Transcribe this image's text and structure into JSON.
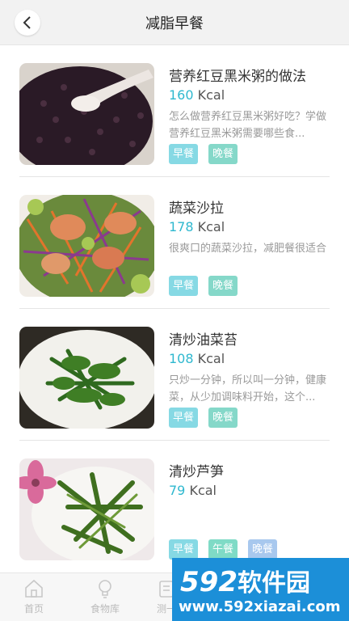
{
  "header": {
    "title": "减脂早餐",
    "back_icon": "chevron-left-icon"
  },
  "recipes": [
    {
      "name": "营养红豆黑米粥的做法",
      "kcal_value": "160",
      "kcal_unit": "Kcal",
      "description": "怎么做营养红豆黑米粥好吃？学做营养红豆黑米粥需要哪些食...",
      "tags": [
        "早餐",
        "晚餐"
      ]
    },
    {
      "name": "蔬菜沙拉",
      "kcal_value": "178",
      "kcal_unit": "Kcal",
      "description": "很爽口的蔬菜沙拉，减肥餐很适合",
      "tags": [
        "早餐",
        "晚餐"
      ]
    },
    {
      "name": "清炒油菜苔",
      "kcal_value": "108",
      "kcal_unit": "Kcal",
      "description": "只炒一分钟，所以叫一分钟，健康菜，从少加调味料开始，这个...",
      "tags": [
        "早餐",
        "晚餐"
      ]
    },
    {
      "name": "清炒芦笋",
      "kcal_value": "79",
      "kcal_unit": "Kcal",
      "description": "",
      "tags": [
        "早餐",
        "午餐",
        "晚餐"
      ]
    }
  ],
  "tabbar": {
    "items": [
      {
        "label": "首页",
        "icon": "home-icon"
      },
      {
        "label": "食物库",
        "icon": "lightbulb-icon"
      },
      {
        "label": "测一",
        "icon": "measure-icon"
      }
    ]
  },
  "watermark": {
    "brand_num": "592",
    "brand_text": "软件园",
    "url": "www.592xiazai.com"
  },
  "colors": {
    "accent": "#2fb8cf",
    "tag_breakfast": "#86d9e4",
    "tag_lunch": "#7fdbc6",
    "tag_dinner_alt": "#a8c8ee"
  }
}
